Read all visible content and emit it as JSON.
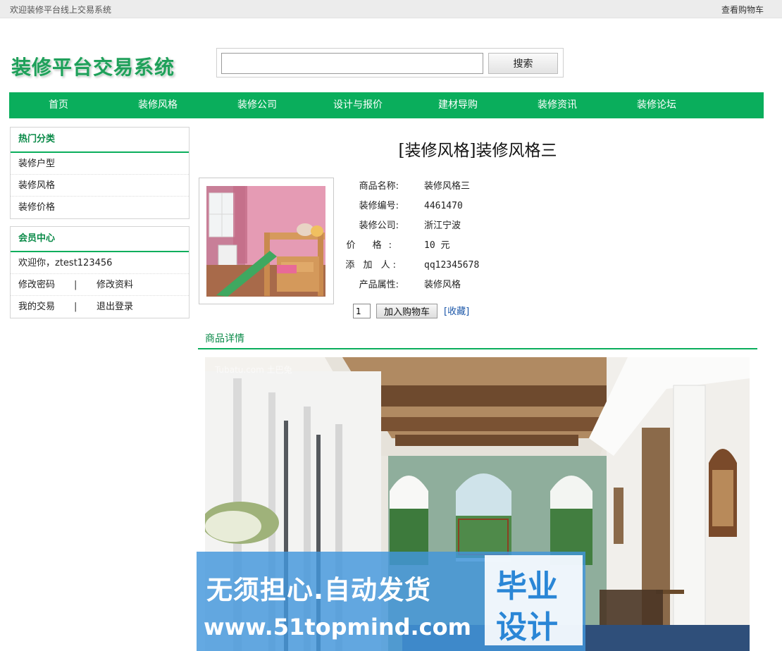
{
  "topbar": {
    "welcome": "欢迎装修平台线上交易系统",
    "cart_link": "查看购物车"
  },
  "logo": "装修平台交易系统",
  "search": {
    "value": "",
    "placeholder": "",
    "button": "搜索"
  },
  "nav": [
    "首页",
    "装修风格",
    "装修公司",
    "设计与报价",
    "建材导购",
    "装修资讯",
    "装修论坛"
  ],
  "sidebar": {
    "hot": {
      "title": "热门分类",
      "items": [
        "装修户型",
        "装修风格",
        "装修价格"
      ]
    },
    "member": {
      "title": "会员中心",
      "welcome": "欢迎你，ztest123456",
      "change_password": "修改密码",
      "edit_profile": "修改资料",
      "my_trades": "我的交易",
      "logout": "退出登录",
      "separator": "|"
    }
  },
  "product": {
    "title": "[装修风格]装修风格三",
    "fields": [
      {
        "label": "商品名称:",
        "value": "装修风格三"
      },
      {
        "label": "装修编号:",
        "value": "4461470"
      },
      {
        "label": "装修公司:",
        "value": "浙江宁波"
      },
      {
        "label": "价 格:",
        "value": "10 元"
      },
      {
        "label": "添 加 人:",
        "value": "qq12345678"
      },
      {
        "label": "产品属性:",
        "value": "装修风格"
      }
    ],
    "quantity": "1",
    "add_to_cart": "加入购物车",
    "favorite": "[收藏]"
  },
  "details_tab": "商品详情",
  "image_watermark": "Tubatu.com 土巴兔",
  "promo": {
    "line1": "无须担心.自动发货",
    "line2": "www.51topmind.com",
    "badge_top": "毕业",
    "badge_bottom": "设计"
  },
  "colors": {
    "accent": "#0aae5c",
    "accent_text": "#0a8a48",
    "promo": "#4296dc"
  }
}
